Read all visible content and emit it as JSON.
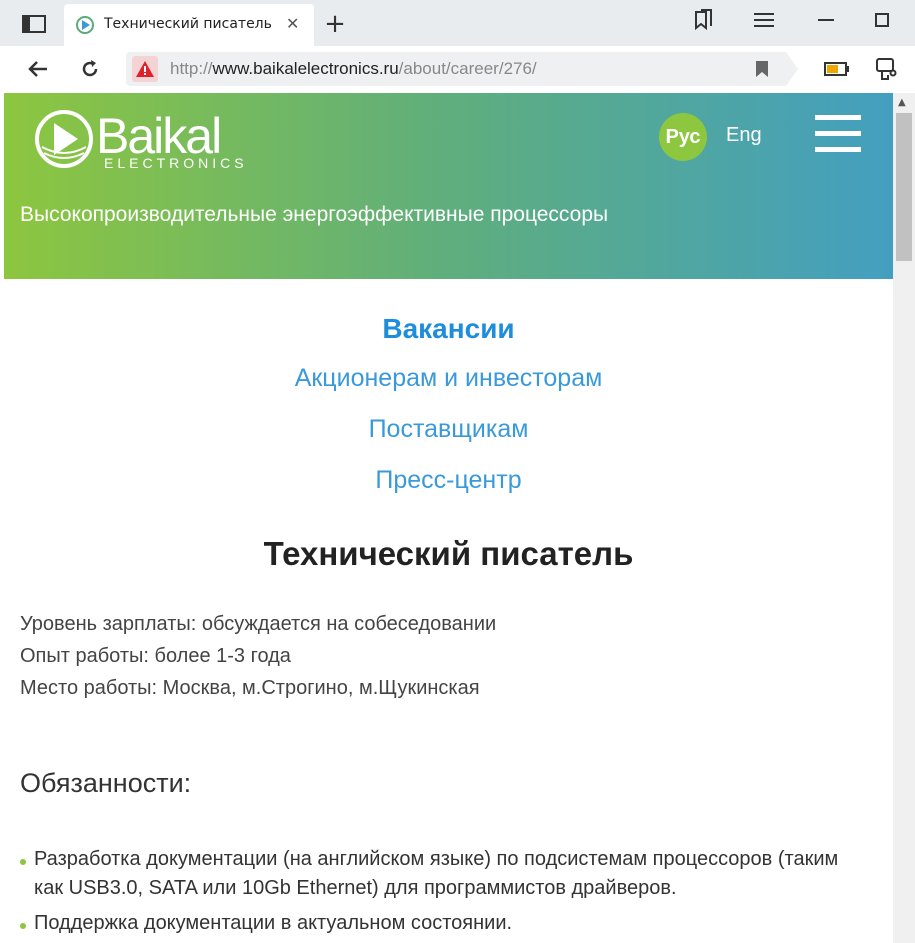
{
  "browser": {
    "tab_title": "Технический писатель",
    "tab_close": "✕",
    "new_tab": "+",
    "url_prefix": "http://",
    "url_domain": "www.baikalelectronics.ru",
    "url_path": "/about/career/276/",
    "icons": [
      "sidebar-icon",
      "new-tab-icon",
      "bookmarks-icon",
      "menu-icon",
      "minimize-icon",
      "maximize-icon",
      "back-icon",
      "reload-icon",
      "warning-icon",
      "bookmark-icon",
      "battery-icon",
      "extension-icon"
    ]
  },
  "site": {
    "logo_text": "Baikal",
    "logo_sub": "ELECTRONICS",
    "lang_ru": "Рус",
    "lang_en": "Eng",
    "tagline": "Высокопроизводительные энергоэффективные процессоры",
    "accent_green": "#8dc63f",
    "accent_blue": "#3a9ad9"
  },
  "menu": {
    "vacancies": "Вакансии",
    "investors": "Акционерам и инвесторам",
    "suppliers": "Поставщикам",
    "press": "Пресс-центр"
  },
  "job": {
    "title": "Технический писатель",
    "salary": "Уровень зарплаты: обсуждается на собеседовании",
    "experience": "Опыт работы: более 1-3 года",
    "location": "Место работы: Москва, м.Строгино, м.Щукинская",
    "duties_heading": "Обязанности:",
    "duties": [
      "Разработка документации (на английском языке) по подсистемам процессоров (таким как USB3.0, SATA или 10Gb Ethernet) для программистов драйверов.",
      "Поддержка документации в актуальном состоянии."
    ]
  }
}
